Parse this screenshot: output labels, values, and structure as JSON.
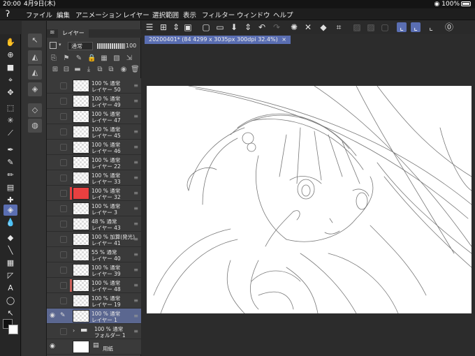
{
  "status_bar": {
    "time": "20:00",
    "date": "4月9日(木)",
    "battery": "100%"
  },
  "menu": {
    "items": [
      "ファイル",
      "編集",
      "アニメーション",
      "レイヤー",
      "選択範囲",
      "表示",
      "フィルター",
      "ウィンドウ",
      "ヘルプ"
    ]
  },
  "layer_panel": {
    "tab_label": "レイヤー",
    "blend_mode": "通常",
    "opacity": "100",
    "layers": [
      {
        "line1": "100 % 通常",
        "line2": "レイヤー 50",
        "thumb": "transparent"
      },
      {
        "line1": "100 % 通常",
        "line2": "レイヤー 49",
        "thumb": "transparent"
      },
      {
        "line1": "100 % 通常",
        "line2": "レイヤー 47",
        "thumb": "transparent"
      },
      {
        "line1": "100 % 通常",
        "line2": "レイヤー 45",
        "thumb": "transparent"
      },
      {
        "line1": "100 % 通常",
        "line2": "レイヤー 46",
        "thumb": "transparent"
      },
      {
        "line1": "100 % 通常",
        "line2": "レイヤー 22",
        "thumb": "transparent"
      },
      {
        "line1": "100 % 通常",
        "line2": "レイヤー 33",
        "thumb": "transparent"
      },
      {
        "line1": "100 % 通常",
        "line2": "レイヤー 32",
        "thumb": "red"
      },
      {
        "line1": "100 % 通常",
        "line2": "レイヤー 3",
        "thumb": "transparent"
      },
      {
        "line1": "48 % 通常",
        "line2": "レイヤー 43",
        "thumb": "transparent"
      },
      {
        "line1": "100 % 加算(発光)",
        "line2": "レイヤー 41",
        "thumb": "transparent"
      },
      {
        "line1": "55 % 通常",
        "line2": "レイヤー 40",
        "thumb": "transparent"
      },
      {
        "line1": "100 % 通常",
        "line2": "レイヤー 39",
        "thumb": "transparent"
      },
      {
        "line1": "100 % 通常",
        "line2": "レイヤー 48",
        "thumb": "transparent"
      },
      {
        "line1": "100 % 通常",
        "line2": "レイヤー 19",
        "thumb": "transparent"
      },
      {
        "line1": "100 % 通常",
        "line2": "レイヤー 1",
        "thumb": "transparent",
        "selected": true
      },
      {
        "line1": "100 % 通常",
        "line2": "フォルダー 1",
        "thumb": "folder"
      },
      {
        "line1": "",
        "line2": "用紙",
        "thumb": "white"
      }
    ]
  },
  "canvas": {
    "doc_tab": "20200401* (84 4299 x 3035px 300dpi 32.4%)",
    "close": "×"
  },
  "colors": {
    "accent": "#5a6eb2",
    "selected_layer": "#5b6790",
    "layer_mark": "#e84040"
  }
}
